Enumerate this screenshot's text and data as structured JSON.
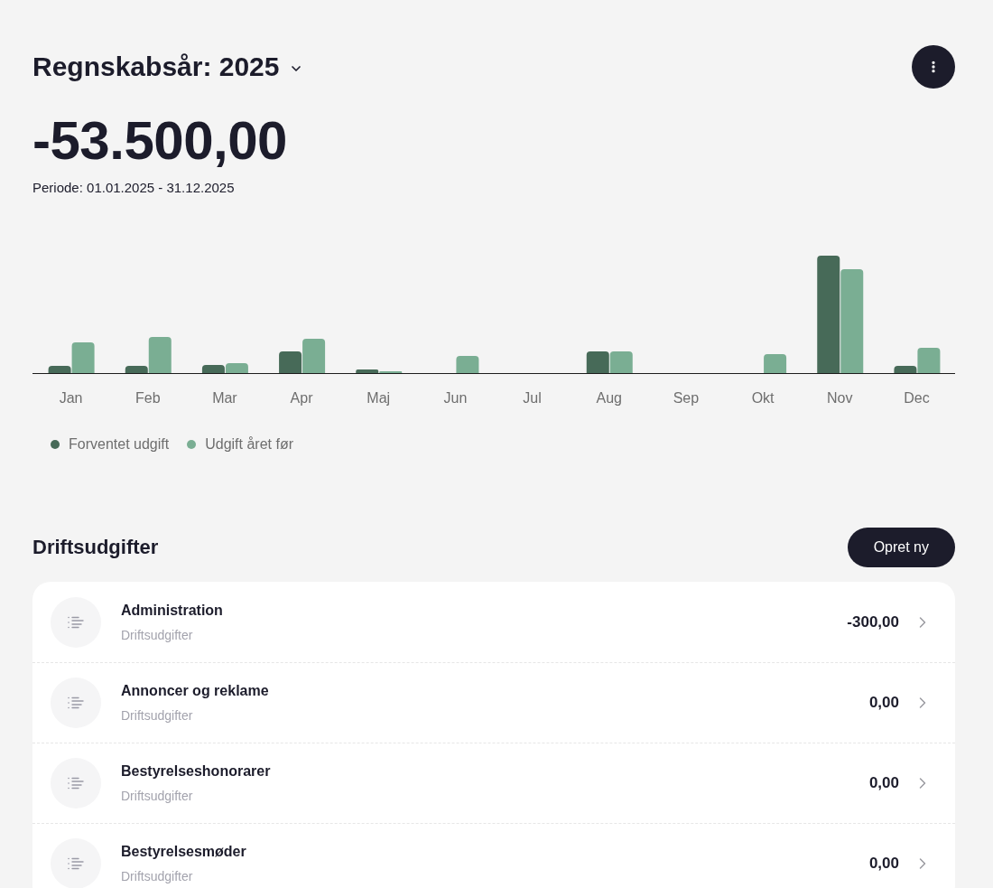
{
  "header": {
    "title": "Regnskabsår: 2025",
    "total": "-53.500,00",
    "period": "Periode: 01.01.2025 - 31.12.2025"
  },
  "chart": {
    "months": [
      "Jan",
      "Feb",
      "Mar",
      "Apr",
      "Maj",
      "Jun",
      "Jul",
      "Aug",
      "Sep",
      "Okt",
      "Nov",
      "Dec"
    ],
    "legend": [
      {
        "label": "Forventet udgift",
        "color": "#476a58"
      },
      {
        "label": "Udgift året før",
        "color": "#7aae93"
      }
    ]
  },
  "section": {
    "title": "Driftsudgifter",
    "button": "Opret ny"
  },
  "rows": [
    {
      "title": "Administration",
      "subtitle": "Driftsudgifter",
      "amount": "-300,00"
    },
    {
      "title": "Annoncer og reklame",
      "subtitle": "Driftsudgifter",
      "amount": "0,00"
    },
    {
      "title": "Bestyrelseshonorarer",
      "subtitle": "Driftsudgifter",
      "amount": "0,00"
    },
    {
      "title": "Bestyrelsesmøder",
      "subtitle": "Driftsudgifter",
      "amount": "0,00"
    }
  ]
}
